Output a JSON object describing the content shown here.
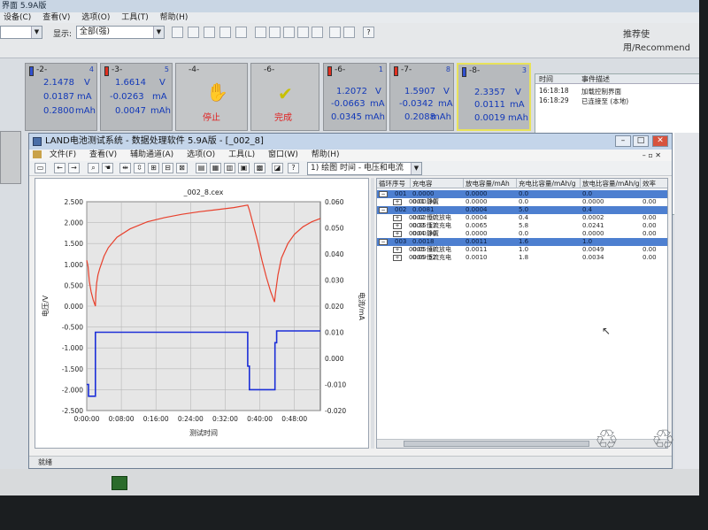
{
  "back_window": {
    "title": "界面 5.9A版",
    "menu": [
      "设备(C)",
      "查看(V)",
      "选项(O)",
      "工具(T)",
      "帮助(H)"
    ],
    "display_label": "显示:",
    "display_value": "全部(强)",
    "recommend": "推荐使用/Recommend"
  },
  "channels": [
    {
      "id": "-2-",
      "num": "4",
      "v": "2.1478",
      "i": "0.0187",
      "c": "0.2800",
      "x": 28
    },
    {
      "id": "-3-",
      "num": "5",
      "v": "1.6614",
      "i": "-0.0263",
      "c": "0.0047",
      "x": 113
    },
    {
      "id": "-4-",
      "status": "停止",
      "icon": "hand-icon",
      "x": 198
    },
    {
      "id": "-6-",
      "status": "完成",
      "icon": "check-icon",
      "x": 283
    },
    {
      "id": "-6-",
      "num": "1",
      "v": "1.2072",
      "i": "-0.0663",
      "c": "0.0345",
      "x": 365
    },
    {
      "id": "-7-",
      "num": "8",
      "v": "1.5907",
      "i": "-0.0342",
      "c": "0.2088",
      "x": 440
    },
    {
      "id": "-8-",
      "num": "3",
      "v": "2.3357",
      "i": "0.0111",
      "c": "0.0019",
      "x": 516
    }
  ],
  "units": {
    "v": "V",
    "i": "mA",
    "c": "mAh"
  },
  "log": {
    "head_time": "时间",
    "head_event": "事件描述",
    "rows": [
      {
        "time": "16:18:18",
        "event": "加载控制界面"
      },
      {
        "time": "16:18:29",
        "event": "已连接至  (本地)"
      }
    ]
  },
  "window": {
    "title": "LAND电池测试系统 - 数据处理软件 5.9A版 - [_002_8]",
    "menu": [
      "文件(F)",
      "查看(V)",
      "辅助通道(A)",
      "选项(O)",
      "工具(L)",
      "窗口(W)",
      "帮助(H)"
    ],
    "view_combo": "1) 绘图  时间 - 电压和电流",
    "status": "就绪"
  },
  "table": {
    "headers": [
      "循环序号",
      "充电容",
      "放电容量/mAh",
      "充电比容量/mAh/g",
      "放电比容量/mAh/g",
      "效率"
    ],
    "rows": [
      {
        "type": "cycle",
        "c0": "001",
        "c1": "0.0000",
        "c2": "0.0000",
        "c3": "0.0",
        "c4": "0.0"
      },
      {
        "type": "step",
        "c0": "0001 静置",
        "c1": "0:00:30",
        "c2": "0.0000",
        "c3": "0.0",
        "c4": "0.0000",
        "c5": "0.00"
      },
      {
        "type": "cycle",
        "c0": "002",
        "c1": "0.0081",
        "c2": "0.0004",
        "c3": "5.0",
        "c4": "0.4"
      },
      {
        "type": "step",
        "c0": "0002 恒流放电",
        "c1": "0:02:00",
        "c2": "0.0004",
        "c3": "0.4",
        "c4": "0.0002",
        "c5": "0.00"
      },
      {
        "type": "step",
        "c0": "0003 恒流充电",
        "c1": "0:35:13",
        "c2": "0.0065",
        "c3": "5.8",
        "c4": "0.0241",
        "c5": "0.00"
      },
      {
        "type": "step",
        "c0": "0004 静置",
        "c1": "0:00:30",
        "c2": "0.0000",
        "c3": "0.0",
        "c4": "0.0000",
        "c5": "0.00"
      },
      {
        "type": "cycle",
        "c0": "003",
        "c1": "0.0018",
        "c2": "0.0011",
        "c3": "1.6",
        "c4": "1.0"
      },
      {
        "type": "step",
        "c0": "0005 恒流放电",
        "c1": "0:05:48",
        "c2": "0.0011",
        "c3": "1.0",
        "c4": "0.0049",
        "c5": "0.00"
      },
      {
        "type": "step",
        "c0": "0006 恒流充电",
        "c1": "0:09:52",
        "c2": "0.0010",
        "c3": "1.8",
        "c4": "0.0034",
        "c5": "0.00"
      }
    ]
  },
  "chart_data": {
    "type": "line",
    "title": "_002_8.cex",
    "xlabel": "测试时间",
    "ylabel": "电压/V",
    "y2label": "电流/mA",
    "xlim": [
      0,
      54
    ],
    "ylim": [
      -2.5,
      2.5
    ],
    "y2lim": [
      -0.02,
      0.06
    ],
    "x_ticks": [
      "0:00:00",
      "0:08:00",
      "0:16:00",
      "0:24:00",
      "0:32:00",
      "0:40:00",
      "0:48:00"
    ],
    "y_ticks": [
      "2.500",
      "2.000",
      "1.500",
      "1.000",
      "0.500",
      "0.000",
      "-0.500",
      "-1.000",
      "-1.500",
      "-2.000",
      "-2.500"
    ],
    "y2_ticks": [
      "0.060",
      "0.050",
      "0.040",
      "0.030",
      "0.020",
      "0.010",
      "0.000",
      "-0.010",
      "-0.020"
    ],
    "grid": true,
    "series": [
      {
        "name": "",
        "axis": "left",
        "color": "#e8402c",
        "x": [
          0,
          0.3,
          0.6,
          1.0,
          1.5,
          2.0,
          2.1,
          2.3,
          2.6,
          3.0,
          4.0,
          5.0,
          7.0,
          10.0,
          14.0,
          18.0,
          22.0,
          26.0,
          30.0,
          34.0,
          37.2,
          37.6,
          38.5,
          39.5,
          40.5,
          41.5,
          42.5,
          43.4,
          43.6,
          44.2,
          45.0,
          46.5,
          48.0,
          50.0,
          52.0,
          54.0
        ],
        "y": [
          1.1,
          0.95,
          0.6,
          0.35,
          0.15,
          0.0,
          0.3,
          0.55,
          0.75,
          0.9,
          1.2,
          1.4,
          1.65,
          1.85,
          2.02,
          2.12,
          2.2,
          2.26,
          2.31,
          2.36,
          2.42,
          2.3,
          1.95,
          1.55,
          1.1,
          0.7,
          0.35,
          0.1,
          0.3,
          0.75,
          1.15,
          1.5,
          1.72,
          1.9,
          2.02,
          2.1
        ]
      },
      {
        "name": "",
        "axis": "right",
        "color": "#1c2fd8",
        "x": [
          0,
          0.4,
          0.4,
          2.0,
          2.0,
          37.2,
          37.2,
          37.6,
          37.6,
          43.5,
          43.5,
          43.9,
          43.9,
          54
        ],
        "y": [
          -0.01,
          -0.01,
          -0.0145,
          -0.0145,
          0.01,
          0.01,
          -0.003,
          -0.003,
          -0.012,
          -0.012,
          0.006,
          0.006,
          0.0105,
          0.0105
        ]
      }
    ]
  }
}
